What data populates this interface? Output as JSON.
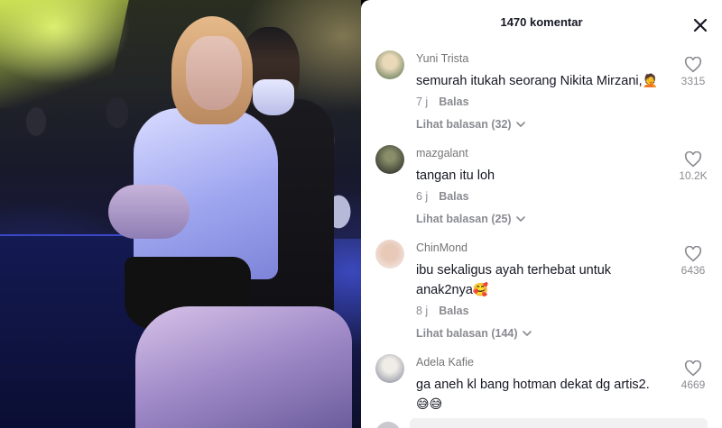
{
  "panel": {
    "title": "1470 komentar",
    "close_icon": "close-icon"
  },
  "comments": [
    {
      "username": "Yuni Trista",
      "text": "semurah itukah seorang Nikita Mirzani,",
      "emoji": "🤦",
      "time": "7 j",
      "reply_label": "Balas",
      "view_replies": "Lihat balasan (32)",
      "likes": "3315"
    },
    {
      "username": "mazgalant",
      "text": "tangan itu loh",
      "emoji": "",
      "time": "6 j",
      "reply_label": "Balas",
      "view_replies": "Lihat balasan (25)",
      "likes": "10.2K"
    },
    {
      "username": "ChinMond",
      "text": "ibu sekaligus ayah terhebat untuk anak2nya",
      "emoji": "🥰",
      "time": "8 j",
      "reply_label": "Balas",
      "view_replies": "Lihat balasan (144)",
      "likes": "6436"
    },
    {
      "username": "Adela Kafie",
      "text": "ga aneh kl bang hotman dekat dg artis2.",
      "emoji": "😅😅",
      "likes": "4669"
    }
  ]
}
